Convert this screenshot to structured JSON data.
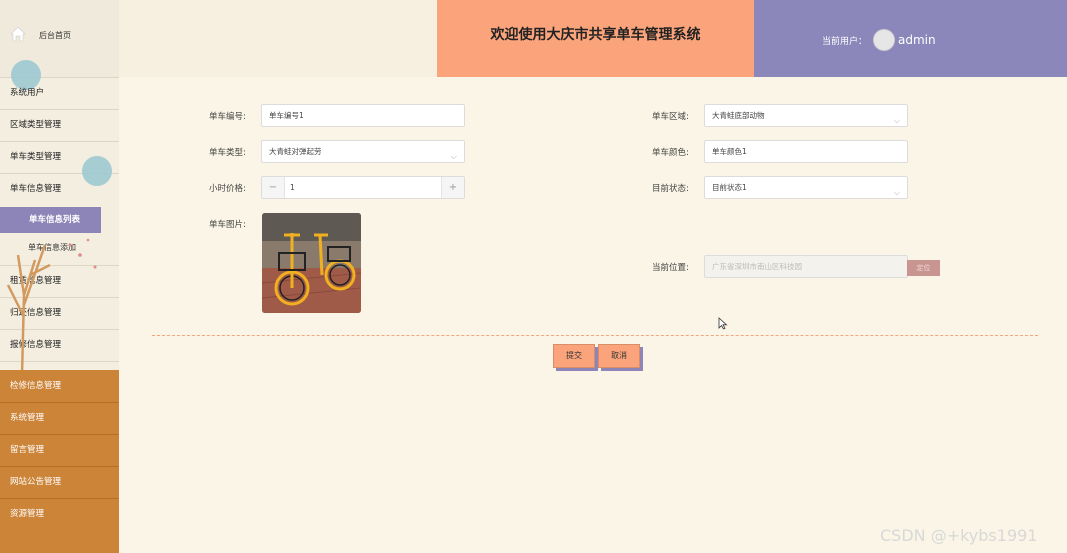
{
  "sidebar": {
    "home_label": "后台首页",
    "items": [
      {
        "label": "系统用户"
      },
      {
        "label": "区域类型管理"
      },
      {
        "label": "单车类型管理"
      },
      {
        "label": "单车信息管理"
      }
    ],
    "sub_items": [
      {
        "label": "单车信息列表",
        "active": true
      },
      {
        "label": "单车信息添加",
        "active": false
      }
    ],
    "items2": [
      {
        "label": "租赁信息管理"
      },
      {
        "label": "归还信息管理"
      },
      {
        "label": "报修信息管理"
      }
    ],
    "orange_items": [
      {
        "label": "检修信息管理"
      },
      {
        "label": "系统管理"
      },
      {
        "label": "留言管理"
      },
      {
        "label": "网站公告管理"
      },
      {
        "label": "资源管理"
      }
    ]
  },
  "header": {
    "title": "欢迎使用大庆市共享单车管理系统",
    "user_label": "当前用户：",
    "username": "admin"
  },
  "form": {
    "bike_no": {
      "label": "单车编号:",
      "value": "单车编号1"
    },
    "bike_type": {
      "label": "单车类型:",
      "value": "大青蛙对弹起劳"
    },
    "hourly_price": {
      "label": "小时价格:",
      "value": "1",
      "minus": "−",
      "plus": "+"
    },
    "bike_image": {
      "label": "单车图片:"
    },
    "bike_area": {
      "label": "单车区域:",
      "value": "大青蛙底部动物"
    },
    "bike_color": {
      "label": "单车颜色:",
      "value": "单车颜色1"
    },
    "current_status": {
      "label": "目前状态:",
      "value": "目前状态1"
    },
    "current_location": {
      "label": "当前位置:",
      "value": "广东省深圳市南山区科技园",
      "button": "定位"
    }
  },
  "actions": {
    "submit": "提交",
    "cancel": "取消"
  },
  "watermark": "CSDN @+kybs1991",
  "colors": {
    "title_bg": "#fba47c",
    "user_bg": "#8c87bb",
    "sidebar_orange": "#cc8438",
    "active_sub": "#8d85b8"
  }
}
